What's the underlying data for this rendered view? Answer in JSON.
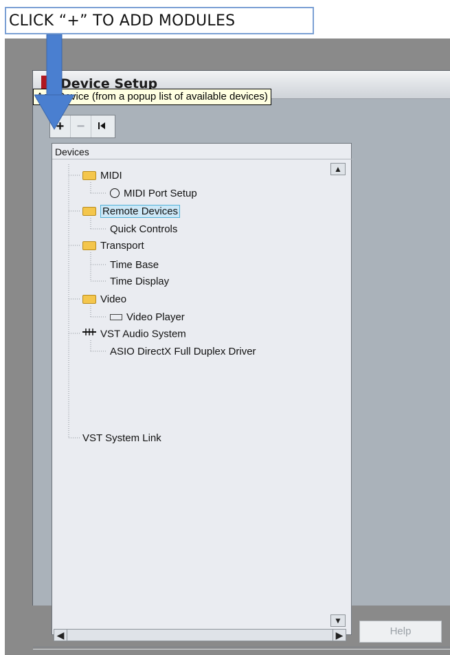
{
  "annotation": {
    "text": "CLICK “+” TO ADD MODULES"
  },
  "window": {
    "title": "Device Setup"
  },
  "toolbar": {
    "add": "+",
    "remove": "−",
    "reset": "⏮"
  },
  "panel": {
    "header": "Devices"
  },
  "tooltip": {
    "text": "Add Device (from a popup list of available devices)"
  },
  "tree": {
    "midi": "MIDI",
    "midi_port_setup": "MIDI Port Setup",
    "remote_devices": "Remote Devices",
    "quick_controls": "Quick Controls",
    "transport": "Transport",
    "time_base": "Time Base",
    "time_display": "Time Display",
    "video": "Video",
    "video_player": "Video Player",
    "vst_audio_system": "VST Audio System",
    "asio_driver": "ASIO DirectX Full Duplex Driver",
    "vst_system_link": "VST System Link"
  },
  "buttons": {
    "help": "Help"
  },
  "colors": {
    "accent": "#4a7fd0",
    "window_bg": "#aab2ba",
    "selection": "#4fb0d8"
  }
}
